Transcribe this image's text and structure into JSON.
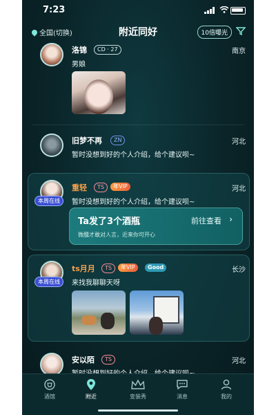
{
  "status": {
    "time": "7:23"
  },
  "header": {
    "location": "全国(切换)",
    "title": "附近同好",
    "boost_label": "10倍曝光"
  },
  "users": [
    {
      "name": "洛锦",
      "tags": [
        "CD · 27"
      ],
      "city": "南京",
      "bio": "男娘",
      "online": ""
    },
    {
      "name": "旧梦不再",
      "tags": [
        "ZN"
      ],
      "city": "河北",
      "bio": "暂时没想到好的个人介绍，给个建议呗~",
      "online": ""
    },
    {
      "name": "重轻",
      "tags": [
        "TS",
        "年VIP"
      ],
      "city": "河北",
      "bio": "暂时没想到好的个人介绍，给个建议呗~",
      "online": "本周在线"
    },
    {
      "name": "ts月月",
      "tags": [
        "TS",
        "年VIP",
        "Good"
      ],
      "city": "长沙",
      "bio": "来找我聊聊天呀",
      "online": "本周在线"
    },
    {
      "name": "安以陌",
      "tags": [
        "TS"
      ],
      "city": "河北",
      "bio": "暂时没想到好的个人介绍，给个建议呗~",
      "online": ""
    }
  ],
  "promo": {
    "title": "Ta发了3个酒瓶",
    "link": "前往查看",
    "chevron": "›",
    "subtitle": "微醺才敢对人言，近来你可开心"
  },
  "tabs": [
    {
      "label": "酒馆",
      "icon": "tavern-icon"
    },
    {
      "label": "附近",
      "icon": "nearby-icon"
    },
    {
      "label": "变装秀",
      "icon": "crown-icon"
    },
    {
      "label": "消息",
      "icon": "message-icon"
    },
    {
      "label": "我的",
      "icon": "profile-icon"
    }
  ],
  "active_tab": "附近",
  "colors": {
    "accent": "#7fe7da",
    "bg": "#0a2428",
    "vip": "#f6a04a",
    "ts": "#ff8a95"
  }
}
